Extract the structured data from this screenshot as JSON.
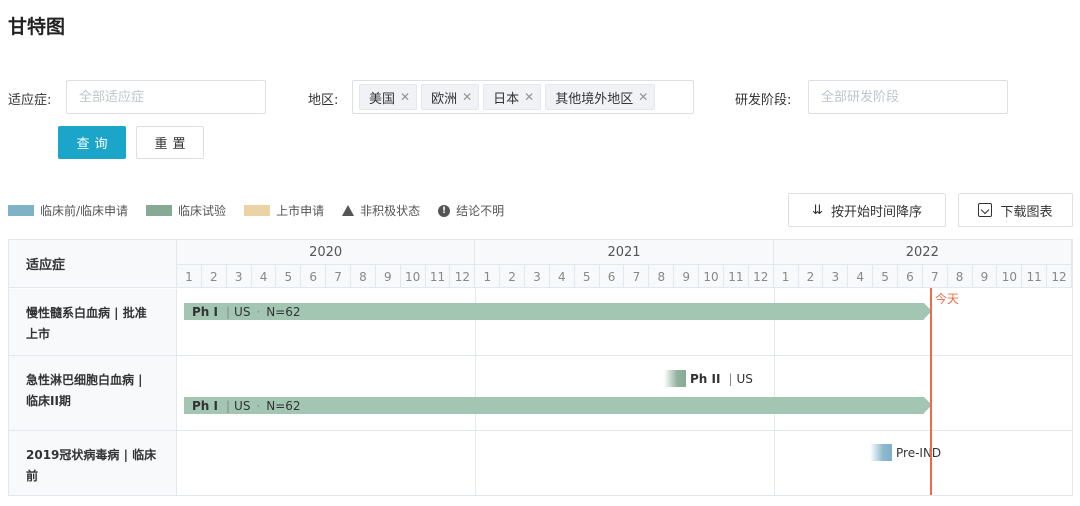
{
  "page_title": "甘特图",
  "filters": {
    "indication_label": "适应症:",
    "indication_placeholder": "全部适应症",
    "region_label": "地区:",
    "region_tags": [
      "美国",
      "欧洲",
      "日本",
      "其他境外地区"
    ],
    "stage_label": "研发阶段:",
    "stage_placeholder": "全部研发阶段"
  },
  "buttons": {
    "query": "查询",
    "reset": "重置"
  },
  "legend": {
    "items": [
      {
        "label": "临床前/临床申请",
        "color": "#7fb1c7"
      },
      {
        "label": "临床试验",
        "color": "#86aa93"
      },
      {
        "label": "上市申请",
        "color": "#ecd3a6"
      }
    ],
    "inactive": "非积极状态",
    "unclear": "结论不明"
  },
  "toolbar": {
    "sort": "按开始时间降序",
    "download": "下载图表"
  },
  "gantt": {
    "column_header": "适应症",
    "years": [
      "2020",
      "2021",
      "2022"
    ],
    "months": [
      "1",
      "2",
      "3",
      "4",
      "5",
      "6",
      "7",
      "8",
      "9",
      "10",
      "11",
      "12"
    ],
    "today_label": "今天",
    "today_position": {
      "year": "2022",
      "month": "7"
    },
    "rows": [
      {
        "label_line1": "慢性髓系白血病 | 批准",
        "label_line2": "上市",
        "bars": [
          {
            "phase": "Ph I",
            "region": "US",
            "n": "N=62",
            "start": "2020-01",
            "end": "2022-06"
          }
        ]
      },
      {
        "label_line1": "急性淋巴细胞白血病 |",
        "label_line2": "临床II期",
        "bars": [
          {
            "phase": "Ph II",
            "region": "US",
            "start": "2021-08"
          },
          {
            "phase": "Ph I",
            "region": "US",
            "n": "N=62",
            "start": "2020-01",
            "end": "2022-06"
          }
        ]
      },
      {
        "label_line1": "2019冠状病毒病 | 临床",
        "label_line2": "前",
        "bars": [
          {
            "phase": "Pre-IND",
            "start": "2022-05"
          }
        ]
      }
    ]
  },
  "colors": {
    "accent": "#1ba5c9",
    "today": "#ee6b47",
    "bar_trial": "#a3c6b2"
  }
}
